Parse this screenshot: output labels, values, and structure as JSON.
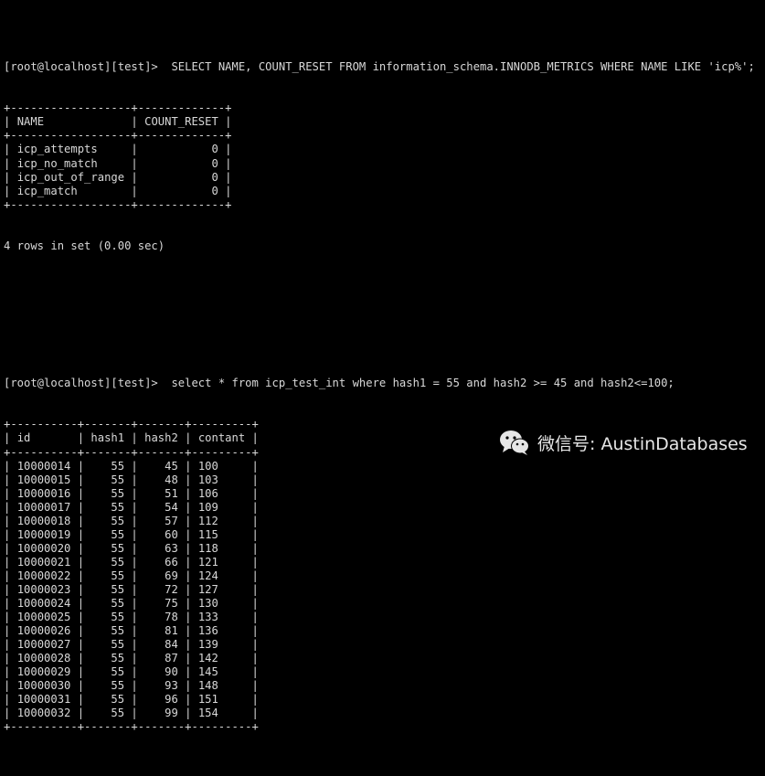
{
  "terminal": {
    "prompt": "[root@localhost][test]>",
    "query1": {
      "command": "SELECT NAME, COUNT_RESET FROM information_schema.INNODB_METRICS WHERE NAME LIKE 'icp%';",
      "columns": [
        "NAME",
        "COUNT_RESET"
      ],
      "rows": [
        [
          "icp_attempts",
          "0"
        ],
        [
          "icp_no_match",
          "0"
        ],
        [
          "icp_out_of_range",
          "0"
        ],
        [
          "icp_match",
          "0"
        ]
      ],
      "summary": "4 rows in set (0.00 sec)"
    },
    "query2": {
      "command": "select * from icp_test_int where hash1 = 55 and hash2 >= 45 and hash2<=100;",
      "columns": [
        "id",
        "hash1",
        "hash2",
        "contant"
      ],
      "rows": [
        [
          "10000014",
          "55",
          "45",
          "100"
        ],
        [
          "10000015",
          "55",
          "48",
          "103"
        ],
        [
          "10000016",
          "55",
          "51",
          "106"
        ],
        [
          "10000017",
          "55",
          "54",
          "109"
        ],
        [
          "10000018",
          "55",
          "57",
          "112"
        ],
        [
          "10000019",
          "55",
          "60",
          "115"
        ],
        [
          "10000020",
          "55",
          "63",
          "118"
        ],
        [
          "10000021",
          "55",
          "66",
          "121"
        ],
        [
          "10000022",
          "55",
          "69",
          "124"
        ],
        [
          "10000023",
          "55",
          "72",
          "127"
        ],
        [
          "10000024",
          "55",
          "75",
          "130"
        ],
        [
          "10000025",
          "55",
          "78",
          "133"
        ],
        [
          "10000026",
          "55",
          "81",
          "136"
        ],
        [
          "10000027",
          "55",
          "84",
          "139"
        ],
        [
          "10000028",
          "55",
          "87",
          "142"
        ],
        [
          "10000029",
          "55",
          "90",
          "145"
        ],
        [
          "10000030",
          "55",
          "93",
          "148"
        ],
        [
          "10000031",
          "55",
          "96",
          "151"
        ],
        [
          "10000032",
          "55",
          "99",
          "154"
        ]
      ]
    }
  },
  "watermark": {
    "icon": "wechat-icon",
    "text": "微信号: AustinDatabases"
  }
}
